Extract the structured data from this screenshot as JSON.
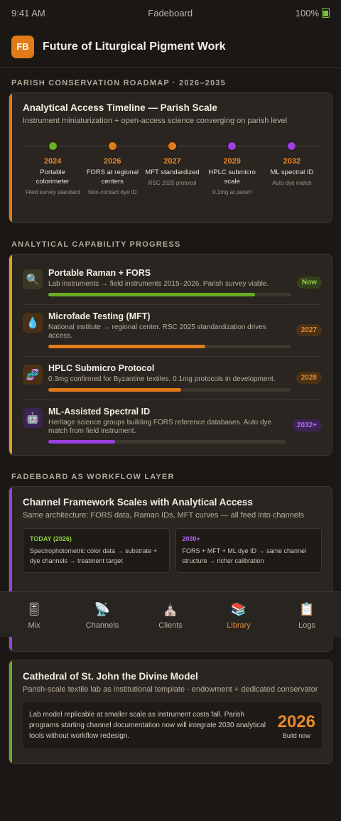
{
  "status_bar": {
    "time": "9:41 AM",
    "app": "Fadeboard",
    "battery": "100%"
  },
  "header": {
    "logo": "FB",
    "title": "Future of Liturgical Pigment Work"
  },
  "roadmap": {
    "section_label": "PARISH CONSERVATION ROADMAP · 2026–2035",
    "title": "Analytical Access Timeline — Parish Scale",
    "subtitle": "Instrument miniaturization + open-access science converging on parish level",
    "accent": "#e07b18",
    "nodes": [
      {
        "year": "2024",
        "label": "Portable colorimeter",
        "note": "Field survey standard",
        "color": "#6aad24"
      },
      {
        "year": "2026",
        "label": "FORS at regional centers",
        "note": "Non-contact dye ID",
        "color": "#e07b18"
      },
      {
        "year": "2027",
        "label": "MFT standardized",
        "note": "RSC 2025 protocol",
        "color": "#e07b18"
      },
      {
        "year": "2029",
        "label": "HPLC submicro scale",
        "note": "0.1mg at parish",
        "color": "#9a3fe0"
      },
      {
        "year": "2032",
        "label": "ML spectral ID",
        "note": "Auto dye match",
        "color": "#9a3fe0"
      }
    ]
  },
  "capabilities": {
    "section_label": "ANALYTICAL CAPABILITY PROGRESS",
    "accent": "#e0a020",
    "items": [
      {
        "icon": "magnifier-icon",
        "glyph": "🔍",
        "title": "Portable Raman + FORS",
        "desc": "Lab instruments → field instruments 2015–2026. Parish survey viable.",
        "badge": "Now",
        "progress": 0.85,
        "color": "#6aad24",
        "badge_bg": "#33421c",
        "badge_fg": "#8fcf45",
        "icon_bg": "#3a3a24"
      },
      {
        "icon": "droplet-icon",
        "glyph": "💧",
        "title": "Microfade Testing (MFT)",
        "desc": "National institute → regional center. RSC 2025 standardization drives access.",
        "badge": "2027",
        "progress": 0.65,
        "color": "#e07b18",
        "badge_bg": "#4a3116",
        "badge_fg": "#e8892a",
        "icon_bg": "#4a3116"
      },
      {
        "icon": "dna-icon",
        "glyph": "🧬",
        "title": "HPLC Submicro Protocol",
        "desc": "0.3mg confirmed for Byzantine textiles. 0.1mg protocols in development.",
        "badge": "2028",
        "progress": 0.55,
        "color": "#e07b18",
        "badge_bg": "#4a3116",
        "badge_fg": "#e8892a",
        "icon_bg": "#4a3116"
      },
      {
        "icon": "robot-icon",
        "glyph": "🤖",
        "title": "ML-Assisted Spectral ID",
        "desc": "Heritage science groups building FORS reference databases. Auto dye match from field instrument.",
        "badge": "2032+",
        "progress": 0.28,
        "color": "#9a3fe0",
        "badge_bg": "#3b2452",
        "badge_fg": "#b06cf0",
        "icon_bg": "#3b2452"
      }
    ]
  },
  "workflow": {
    "section_label": "FADEBOARD AS WORKFLOW LAYER",
    "title": "Channel Framework Scales with Analytical Access",
    "subtitle": "Same architecture: FORS data, Raman IDs, MFT curves — all feed into channels",
    "accent": "#9a3fe0",
    "today": {
      "head": "TODAY (2026)",
      "text": "Spectrophotometric color data → substrate + dye channels → treatment target",
      "color": "#8fcf45"
    },
    "future": {
      "head": "2030+",
      "text": "FORS + MFT + ML dye ID → same channel structure → richer calibration",
      "color": "#b06cf0"
    }
  },
  "cathedral": {
    "title": "Cathedral of St. John the Divine Model",
    "subtitle": "Parish-scale textile lab as institutional template · endowment + dedicated conservator",
    "text": "Lab model replicable at smaller scale as instrument costs fall. Parish programs starting channel documentation now will integrate 2030 analytical tools without workflow redesign.",
    "year": "2026",
    "year_label": "Build now",
    "accent": "#6aad24"
  },
  "nav": [
    {
      "icon": "mix-icon",
      "glyph": "🎚",
      "label": "Mix",
      "active": false
    },
    {
      "icon": "satellite-icon",
      "glyph": "📡",
      "label": "Channels",
      "active": false
    },
    {
      "icon": "church-icon",
      "glyph": "⛪",
      "label": "Clients",
      "active": false
    },
    {
      "icon": "books-icon",
      "glyph": "📚",
      "label": "Library",
      "active": true
    },
    {
      "icon": "clipboard-icon",
      "glyph": "📋",
      "label": "Logs",
      "active": false
    }
  ]
}
